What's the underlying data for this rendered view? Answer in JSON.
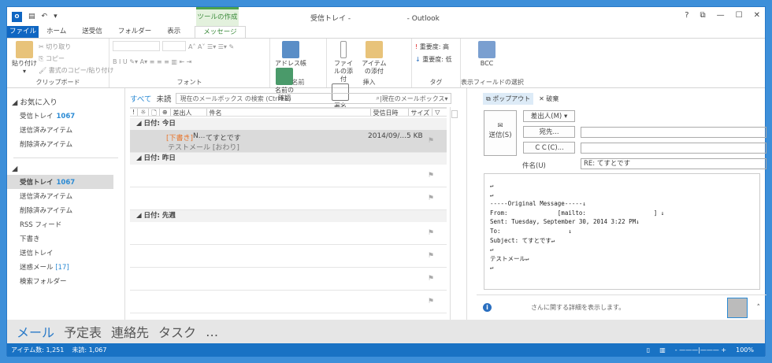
{
  "window": {
    "title": "受信トレイ -",
    "app": "- Outlook",
    "context_tab": "ツールの作成",
    "controls": [
      "?",
      "⧉",
      "—",
      "☐",
      "✕"
    ]
  },
  "tabs": [
    "ファイル",
    "ホーム",
    "送受信",
    "フォルダー",
    "表示",
    "メッセージ"
  ],
  "ribbon": {
    "clipboard": {
      "paste": "貼り付け",
      "cut": "切り取り",
      "copy": "コピー",
      "format_painter": "書式のコピー/貼り付け",
      "label": "クリップボード"
    },
    "font": {
      "label": "フォント"
    },
    "names": {
      "address_book": "アドレス帳",
      "check_names": "名前の確認",
      "label": "名前"
    },
    "insert": {
      "attach_file": "ファイルの添付",
      "attach_item": "アイテムの添付",
      "signature": "署名",
      "label": "挿入"
    },
    "tags": {
      "high": "重要度: 高",
      "low": "重要度: 低",
      "label": "タグ"
    },
    "fields": {
      "bcc": "BCC",
      "label": "表示フィールドの選択"
    }
  },
  "folders": {
    "favorites": {
      "header": "お気に入り",
      "items": [
        {
          "label": "受信トレイ",
          "count": "1067"
        },
        {
          "label": "送信済みアイテム"
        },
        {
          "label": "削除済みアイテム"
        }
      ]
    },
    "mailbox": {
      "items": [
        {
          "label": "受信トレイ",
          "count": "1067"
        },
        {
          "label": "送信済みアイテム"
        },
        {
          "label": "削除済みアイテム"
        },
        {
          "label": "RSS フィード"
        },
        {
          "label": "下書き"
        },
        {
          "label": "送信トレイ"
        },
        {
          "label": "迷惑メール",
          "count": "[17]"
        },
        {
          "label": "検索フォルダー"
        }
      ]
    }
  },
  "list": {
    "filter_all": "すべて",
    "filter_unread": "未読",
    "search_placeholder": "現在のメールボックス の検索 (Ctrl+E)",
    "scope": "現在のメールボックス",
    "columns": [
      "!",
      "☼",
      "🗋",
      "⊕",
      "差出人",
      "件名",
      "受信日時",
      "サイズ",
      "▽"
    ],
    "groups": [
      {
        "label": "日付: 今日"
      },
      {
        "label": "日付: 昨日"
      },
      {
        "label": "日付: 先週"
      }
    ],
    "message": {
      "draft_tag": "[下書き]",
      "sender": "N...",
      "subject": "てすとです",
      "preview": "テストメール [おわり]",
      "date": "2014/09/...",
      "size": "5 KB"
    }
  },
  "compose": {
    "popout": "ポップアウト",
    "discard": "破棄",
    "send": "送信(S)",
    "from": "差出人(M) ▾",
    "to": "宛先...",
    "cc": "ＣＣ(C)...",
    "subject_label": "件名(U)",
    "subject_value": "RE: てすとです",
    "to_value": "",
    "cc_value": "",
    "body": "↵\n↵\n-----Original Message-----↓\nFrom:              [mailto:                   ] ↓\nSent: Tuesday, September 30, 2014 3:22 PM↓\nTo:                   ↓\nSubject: てすとです↵\n↵\nテストメール↵\n↵"
  },
  "people": {
    "text": "さんに関する詳細を表示します。"
  },
  "nav": [
    "メール",
    "予定表",
    "連絡先",
    "タスク",
    "…"
  ],
  "status": {
    "items": "アイテム数: 1,251",
    "unread": "未読: 1,067",
    "zoom": "100%"
  }
}
